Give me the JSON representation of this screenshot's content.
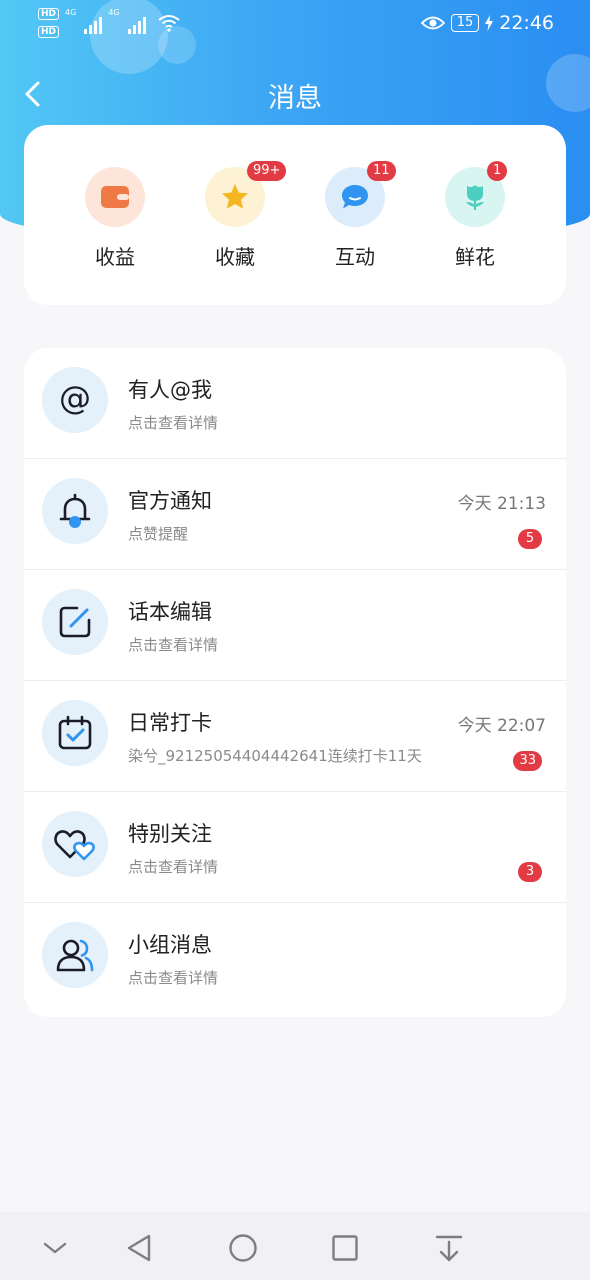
{
  "status_bar": {
    "sim1": "HD",
    "sim2": "HD",
    "net1": "4G",
    "net2": "4G",
    "battery": "15",
    "time": "22:46",
    "icons": [
      "eye-icon",
      "wifi-icon",
      "signal-icon",
      "charging-icon"
    ]
  },
  "header": {
    "title": "消息",
    "back_icon": "chevron-left-icon"
  },
  "shortcuts": [
    {
      "label": "收益",
      "badge": "",
      "icon": "wallet-icon",
      "color": "#f07a45"
    },
    {
      "label": "收藏",
      "badge": "99+",
      "icon": "star-icon",
      "color": "#f5b622"
    },
    {
      "label": "互动",
      "badge": "11",
      "icon": "chat-bubble-icon",
      "color": "#2f95f0"
    },
    {
      "label": "鲜花",
      "badge": "1",
      "icon": "flower-icon",
      "color": "#4ccfc0"
    }
  ],
  "messages": [
    {
      "title": "有人@我",
      "subtitle": "点击查看详情",
      "time": "",
      "badge": "",
      "icon": "at-icon"
    },
    {
      "title": "官方通知",
      "subtitle": "点赞提醒",
      "time": "今天 21:13",
      "badge": "5",
      "icon": "bell-icon"
    },
    {
      "title": "话本编辑",
      "subtitle": "点击查看详情",
      "time": "",
      "badge": "",
      "icon": "edit-icon"
    },
    {
      "title": "日常打卡",
      "subtitle": "染兮_92125054404442641连续打卡11天",
      "time": "今天 22:07",
      "badge": "33",
      "icon": "calendar-check-icon"
    },
    {
      "title": "特别关注",
      "subtitle": "点击查看详情",
      "time": "",
      "badge": "3",
      "icon": "hearts-icon"
    },
    {
      "title": "小组消息",
      "subtitle": "点击查看详情",
      "time": "",
      "badge": "",
      "icon": "group-icon"
    }
  ],
  "colors": {
    "header_gradient_start": "#52c8f5",
    "header_gradient_end": "#2a8ef2",
    "badge": "#e33b44",
    "icon_accent": "#2f95f0",
    "icon_circle": "#e4f1fb"
  },
  "bottom_nav": [
    "chevron-down-icon",
    "back-triangle-icon",
    "home-circle-icon",
    "recents-square-icon",
    "download-icon"
  ]
}
